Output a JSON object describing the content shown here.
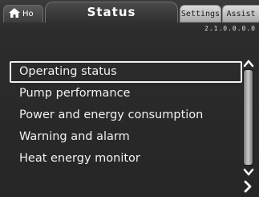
{
  "tabs": {
    "home_label": "Ho",
    "active_title": "Status",
    "settings_label": "Settings",
    "assist_label": "Assist"
  },
  "version": "2.1.0.0.0.0",
  "menu": {
    "items": [
      {
        "label": "Operating status",
        "selected": true
      },
      {
        "label": "Pump performance",
        "selected": false
      },
      {
        "label": "Power and energy consumption",
        "selected": false
      },
      {
        "label": "Warning and alarm",
        "selected": false
      },
      {
        "label": "Heat energy monitor",
        "selected": false
      }
    ]
  },
  "icons": {
    "home": "home-icon",
    "scroll_up": "chevron-up-icon",
    "scroll_down": "chevron-down-icon",
    "next": "chevron-right-icon"
  },
  "colors": {
    "background": "#2b2b2b",
    "text": "#ffffff",
    "inactive_tab": "#c8c8c8"
  }
}
